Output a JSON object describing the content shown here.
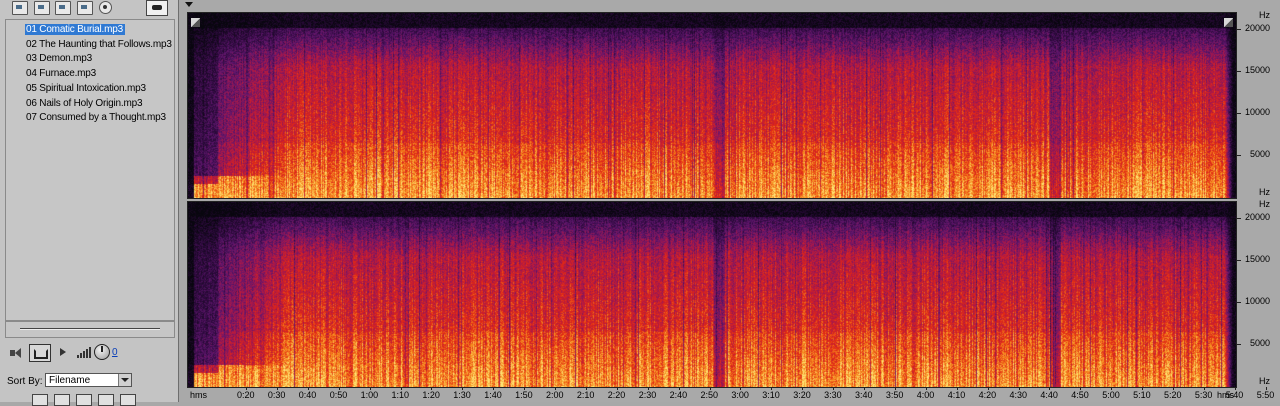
{
  "toolbar": {
    "icons": [
      "open-file-icon",
      "close-file-icon",
      "import-icon",
      "export-icon",
      "disc-icon",
      "view-toggle-icon"
    ]
  },
  "files": [
    {
      "label": "01 Comatic Burial.mp3",
      "selected": true
    },
    {
      "label": "02 The Haunting that Follows.mp3",
      "selected": false
    },
    {
      "label": "03 Demon.mp3",
      "selected": false
    },
    {
      "label": "04 Furnace.mp3",
      "selected": false
    },
    {
      "label": "05 Spiritual Intoxication.mp3",
      "selected": false
    },
    {
      "label": "06 Nails of Holy Origin.mp3",
      "selected": false
    },
    {
      "label": "07 Consumed by a Thought.mp3",
      "selected": false
    }
  ],
  "transport": {
    "volume_value": "0"
  },
  "sort": {
    "label": "Sort By:",
    "selected": "Filename"
  },
  "frequency_axis": {
    "unit": "Hz",
    "ticks": [
      20000,
      15000,
      10000,
      5000
    ],
    "max": 22050
  },
  "time_axis": {
    "unit": "hms",
    "ticks": [
      "0:20",
      "0:30",
      "0:40",
      "0:50",
      "1:00",
      "1:10",
      "1:20",
      "1:30",
      "1:40",
      "1:50",
      "2:00",
      "2:10",
      "2:20",
      "2:30",
      "2:40",
      "2:50",
      "3:00",
      "3:10",
      "3:20",
      "3:30",
      "3:40",
      "3:50",
      "4:00",
      "4:10",
      "4:20",
      "4:30",
      "4:40",
      "4:50",
      "5:00",
      "5:10",
      "5:20",
      "5:30",
      "5:40",
      "5:50"
    ],
    "end_unit": "hms"
  },
  "colors": {
    "selection": "#2f79d3",
    "link": "#0a3fb8"
  }
}
